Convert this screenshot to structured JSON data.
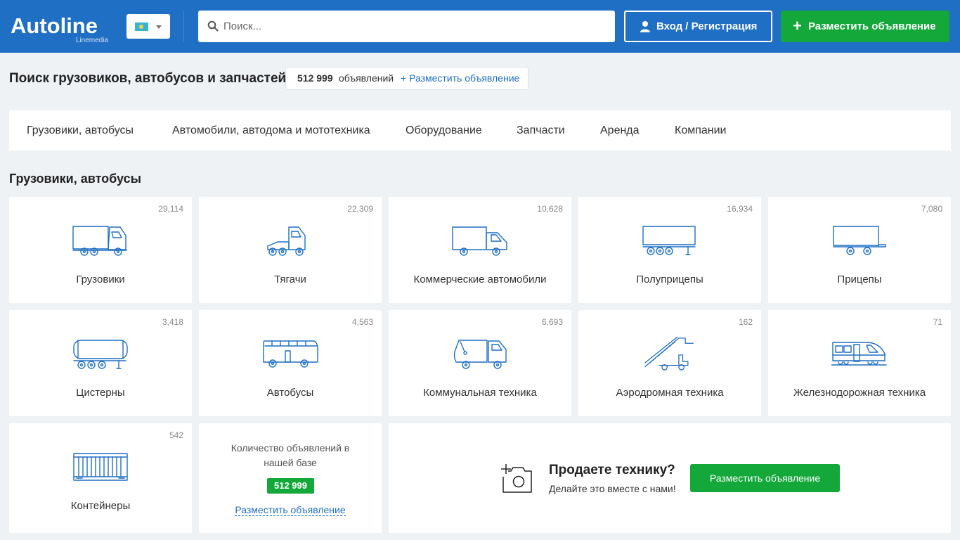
{
  "header": {
    "logo": "Autoline",
    "logo_sub": "Linemedia",
    "search_placeholder": "Поиск...",
    "login_label": "Вход / Регистрация",
    "post_label": "Разместить объявление",
    "colors": {
      "bar": "#1f6fc4",
      "accent": "#14a73a"
    }
  },
  "title": {
    "heading": "Поиск грузовиков, автобусов и запчастей",
    "count": "512 999",
    "count_word": "объявлений",
    "post_link": "+ Разместить объявление"
  },
  "nav": {
    "items": [
      "Грузовики, автобусы",
      "Автомобили, автодома и мототехника",
      "Оборудование",
      "Запчасти",
      "Аренда",
      "Компании"
    ]
  },
  "section": {
    "title": "Грузовики, автобусы"
  },
  "categories": [
    {
      "label": "Грузовики",
      "count": "29,114",
      "icon": "truck-icon"
    },
    {
      "label": "Тягачи",
      "count": "22,309",
      "icon": "tractor-unit-icon"
    },
    {
      "label": "Коммерческие автомобили",
      "count": "10,628",
      "icon": "van-icon"
    },
    {
      "label": "Полуприцепы",
      "count": "16,934",
      "icon": "semitrailer-icon"
    },
    {
      "label": "Прицепы",
      "count": "7,080",
      "icon": "trailer-icon"
    },
    {
      "label": "Цистерны",
      "count": "3,418",
      "icon": "tank-icon"
    },
    {
      "label": "Автобусы",
      "count": "4,563",
      "icon": "bus-icon"
    },
    {
      "label": "Коммунальная техника",
      "count": "6,693",
      "icon": "garbage-truck-icon"
    },
    {
      "label": "Аэродромная техника",
      "count": "162",
      "icon": "airstairs-icon"
    },
    {
      "label": "Железнодорожная техника",
      "count": "71",
      "icon": "train-icon"
    },
    {
      "label": "Контейнеры",
      "count": "542",
      "icon": "container-icon"
    }
  ],
  "stats": {
    "text": "Количество объявлений в нашей базе",
    "badge": "512 999",
    "link": "Разместить объявление"
  },
  "promo": {
    "title": "Продаете технику?",
    "subtitle": "Делайте это вместе с нами!",
    "button": "Разместить объявление"
  }
}
